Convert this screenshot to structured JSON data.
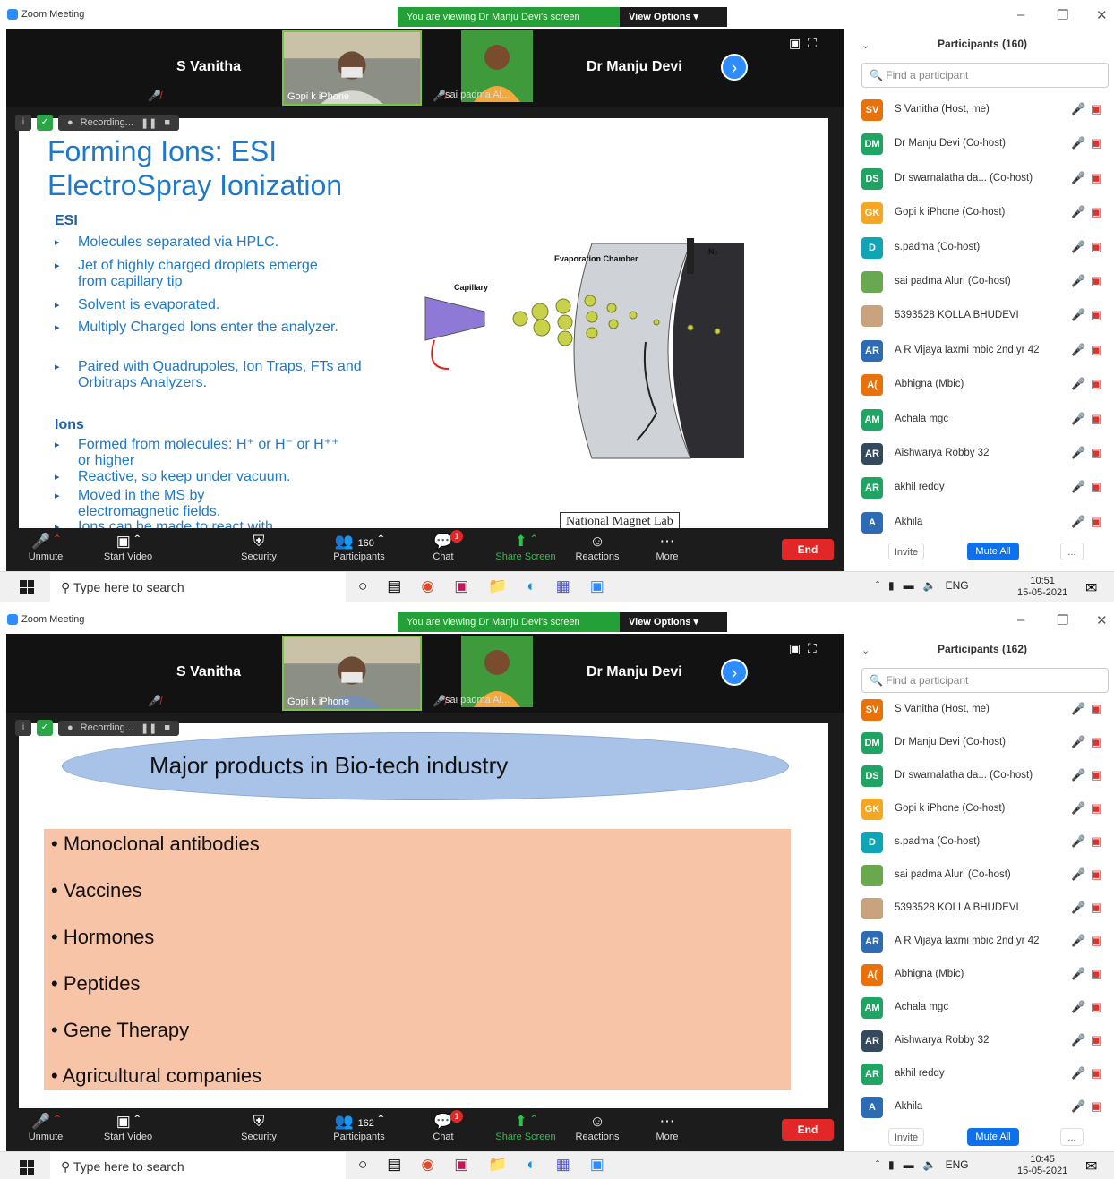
{
  "panels": [
    {
      "window": {
        "title": "Zoom Meeting",
        "banner": "You are viewing Dr Manju Devi's screen",
        "view_options": "View Options ▾"
      },
      "strip": {
        "left_name": "S Vanitha",
        "right_name": "Dr Manju Devi",
        "cam1_label": "Gopi k iPhone",
        "cam2_label": "sai padma Al..."
      },
      "recording": {
        "label": "Recording..."
      },
      "participants": {
        "header": "Participants (160)",
        "search_placeholder": "Find a participant",
        "invite": "Invite",
        "mute_all": "Mute All",
        "more": "...",
        "list": [
          {
            "initials": "SV",
            "color": "#e8710a",
            "name": "S Vanitha (Host, me)"
          },
          {
            "initials": "DM",
            "color": "#1fa463",
            "name": "Dr Manju Devi (Co-host)"
          },
          {
            "initials": "DS",
            "color": "#1fa463",
            "name": "Dr swarnalatha da... (Co-host)"
          },
          {
            "initials": "GK",
            "color": "#f5a623",
            "name": "Gopi k iPhone (Co-host)"
          },
          {
            "initials": "D",
            "color": "#10a5b5",
            "name": "s.padma (Co-host)"
          },
          {
            "initials": "",
            "color": "#6aa84f",
            "name": "sai padma Aluri (Co-host)"
          },
          {
            "initials": "",
            "color": "#c9a27e",
            "name": "5393528 KOLLA BHUDEVI"
          },
          {
            "initials": "AR",
            "color": "#2d6bb5",
            "name": "A R Vijaya laxmi mbic 2nd yr 42"
          },
          {
            "initials": "A(",
            "color": "#e8710a",
            "name": "Abhigna (Mbic)"
          },
          {
            "initials": "AM",
            "color": "#1fa463",
            "name": "Achala mgc"
          },
          {
            "initials": "AR",
            "color": "#34495e",
            "name": "Aishwarya Robby 32"
          },
          {
            "initials": "AR",
            "color": "#1fa463",
            "name": "akhil reddy"
          },
          {
            "initials": "A",
            "color": "#2d6bb5",
            "name": "Akhila"
          }
        ]
      },
      "toolbar": {
        "unmute": "Unmute",
        "start_video": "Start Video",
        "security": "Security",
        "participants_count": "160",
        "participants": "Participants",
        "chat": "Chat",
        "chat_badge": "1",
        "share": "Share Screen",
        "reactions": "Reactions",
        "more": "More",
        "end": "End"
      },
      "taskbar": {
        "search": "Type here to search",
        "lang": "ENG",
        "time": "10:51",
        "date": "15-05-2021"
      },
      "slide": {
        "title1": "Forming Ions: ESI",
        "title2": "ElectroSpray Ionization",
        "esi_heading": "ESI",
        "esi_items": [
          "Molecules separated via HPLC.",
          "Jet of highly charged droplets emerge from capillary tip",
          "Solvent is evaporated.",
          "Multiply Charged Ions enter the analyzer.",
          "Paired with Quadrupoles, Ion Traps, FTs and Orbitraps Analyzers."
        ],
        "ions_heading": "Ions",
        "ions_items": [
          "Formed from molecules: H⁺ or H⁻ or H⁺⁺ or higher",
          "Reactive, so keep under vacuum.",
          "Moved in the MS by electromagnetic fields.",
          "Ions can be made to react with"
        ],
        "fig_capillary": "Capillary",
        "fig_evap": "Evaporation Chamber",
        "fig_n2": "N₂",
        "credit": "National Magnet Lab"
      }
    },
    {
      "window": {
        "title": "Zoom Meeting",
        "banner": "You are viewing Dr Manju Devi's screen",
        "view_options": "View Options ▾"
      },
      "strip": {
        "left_name": "S Vanitha",
        "right_name": "Dr Manju Devi",
        "cam1_label": "Gopi k iPhone",
        "cam2_label": "sai padma Al..."
      },
      "recording": {
        "label": "Recording..."
      },
      "participants": {
        "header": "Participants (162)",
        "search_placeholder": "Find a participant",
        "invite": "Invite",
        "mute_all": "Mute All",
        "more": "...",
        "list": [
          {
            "initials": "SV",
            "color": "#e8710a",
            "name": "S Vanitha (Host, me)"
          },
          {
            "initials": "DM",
            "color": "#1fa463",
            "name": "Dr Manju Devi (Co-host)"
          },
          {
            "initials": "DS",
            "color": "#1fa463",
            "name": "Dr swarnalatha da... (Co-host)"
          },
          {
            "initials": "GK",
            "color": "#f5a623",
            "name": "Gopi k iPhone (Co-host)"
          },
          {
            "initials": "D",
            "color": "#10a5b5",
            "name": "s.padma (Co-host)"
          },
          {
            "initials": "",
            "color": "#6aa84f",
            "name": "sai padma Aluri (Co-host)"
          },
          {
            "initials": "",
            "color": "#c9a27e",
            "name": "5393528 KOLLA BHUDEVI"
          },
          {
            "initials": "AR",
            "color": "#2d6bb5",
            "name": "A R Vijaya laxmi mbic 2nd yr 42"
          },
          {
            "initials": "A(",
            "color": "#e8710a",
            "name": "Abhigna (Mbic)"
          },
          {
            "initials": "AM",
            "color": "#1fa463",
            "name": "Achala mgc"
          },
          {
            "initials": "AR",
            "color": "#34495e",
            "name": "Aishwarya Robby 32"
          },
          {
            "initials": "AR",
            "color": "#1fa463",
            "name": "akhil reddy"
          },
          {
            "initials": "A",
            "color": "#2d6bb5",
            "name": "Akhila"
          }
        ]
      },
      "toolbar": {
        "unmute": "Unmute",
        "start_video": "Start Video",
        "security": "Security",
        "participants_count": "162",
        "participants": "Participants",
        "chat": "Chat",
        "chat_badge": "1",
        "share": "Share Screen",
        "reactions": "Reactions",
        "more": "More",
        "end": "End"
      },
      "taskbar": {
        "search": "Type here to search",
        "lang": "ENG",
        "time": "10:45",
        "date": "15-05-2021"
      },
      "slide": {
        "title": "Major products in Bio-tech industry",
        "items": [
          "Monoclonal antibodies",
          "Vaccines",
          "Hormones",
          "Peptides",
          "Gene Therapy",
          "Agricultural companies"
        ]
      }
    }
  ]
}
